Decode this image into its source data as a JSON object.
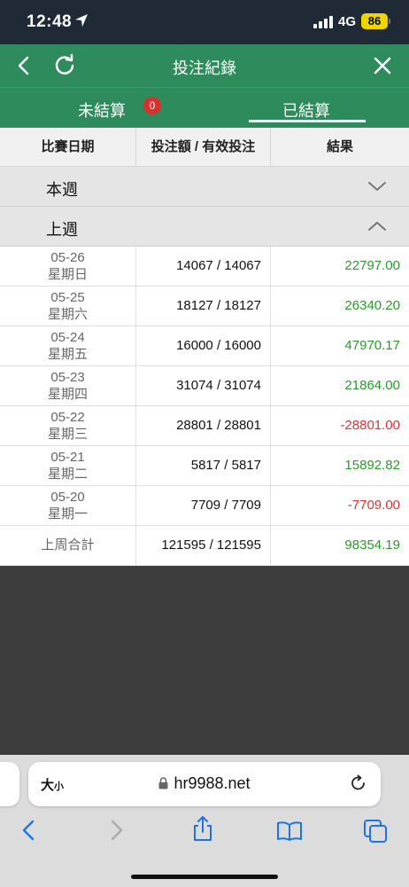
{
  "status_bar": {
    "time": "12:48",
    "network": "4G",
    "battery": "86"
  },
  "header": {
    "title": "投注紀錄"
  },
  "tabs": [
    {
      "label": "未結算",
      "badge": "0"
    },
    {
      "label": "已結算"
    }
  ],
  "table": {
    "columns": [
      "比賽日期",
      "投注額 / 有效投注",
      "結果"
    ],
    "groups": {
      "this_week": "本週",
      "last_week": "上週"
    },
    "rows": [
      {
        "date": "05-26",
        "weekday": "星期日",
        "amount": "14067 / 14067",
        "result": "22797.00"
      },
      {
        "date": "05-25",
        "weekday": "星期六",
        "amount": "18127 / 18127",
        "result": "26340.20"
      },
      {
        "date": "05-24",
        "weekday": "星期五",
        "amount": "16000 / 16000",
        "result": "47970.17"
      },
      {
        "date": "05-23",
        "weekday": "星期四",
        "amount": "31074 / 31074",
        "result": "21864.00"
      },
      {
        "date": "05-22",
        "weekday": "星期三",
        "amount": "28801 / 28801",
        "result": "-28801.00"
      },
      {
        "date": "05-21",
        "weekday": "星期二",
        "amount": "5817 / 5817",
        "result": "15892.82"
      },
      {
        "date": "05-20",
        "weekday": "星期一",
        "amount": "7709 / 7709",
        "result": "-7709.00"
      }
    ],
    "total": {
      "label": "上周合計",
      "amount": "121595 / 121595",
      "result": "98354.19"
    }
  },
  "browser": {
    "text_size_big": "大",
    "text_size_small": "小",
    "url": "hr9988.net"
  },
  "colors": {
    "header_green": "#2e8b5c",
    "positive": "#2a9b2a",
    "negative": "#e53030",
    "badge_red": "#d9302c"
  }
}
